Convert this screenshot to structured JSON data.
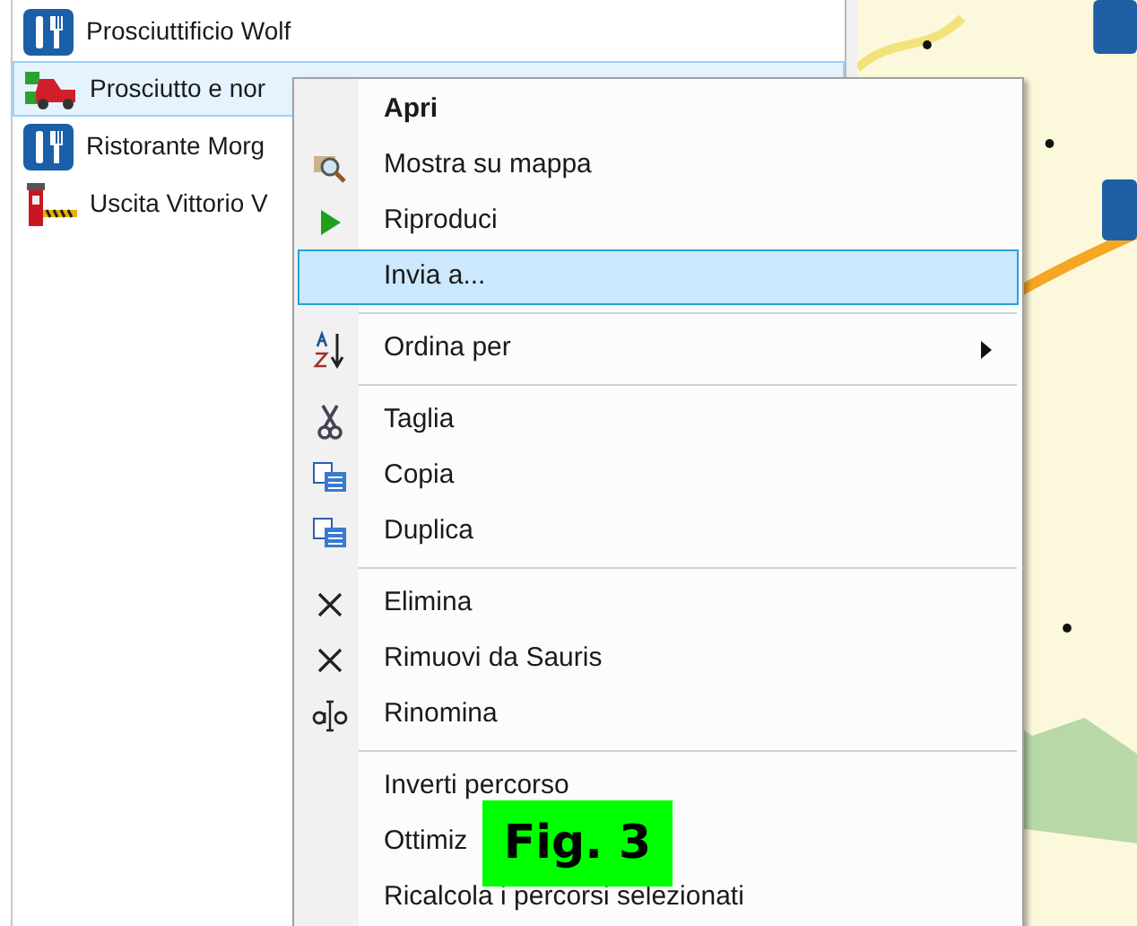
{
  "list": {
    "items": [
      {
        "label": "Prosciuttificio Wolf",
        "selected": false
      },
      {
        "label": "Prosciutto e nor",
        "selected": true
      },
      {
        "label": "Ristorante Morg",
        "selected": false
      },
      {
        "label": "Uscita Vittorio V",
        "selected": false
      }
    ]
  },
  "context_menu": {
    "items": [
      {
        "kind": "item",
        "label": "Apri",
        "default": true,
        "selected": false,
        "submenu": false
      },
      {
        "kind": "item",
        "label": "Mostra su mappa",
        "default": false,
        "selected": false,
        "submenu": false
      },
      {
        "kind": "item",
        "label": "Riproduci",
        "default": false,
        "selected": false,
        "submenu": false
      },
      {
        "kind": "item",
        "label": "Invia a...",
        "default": false,
        "selected": true,
        "submenu": false
      },
      {
        "kind": "separator"
      },
      {
        "kind": "item",
        "label": "Ordina per",
        "default": false,
        "selected": false,
        "submenu": true
      },
      {
        "kind": "separator"
      },
      {
        "kind": "item",
        "label": "Taglia",
        "default": false,
        "selected": false,
        "submenu": false
      },
      {
        "kind": "item",
        "label": "Copia",
        "default": false,
        "selected": false,
        "submenu": false
      },
      {
        "kind": "item",
        "label": "Duplica",
        "default": false,
        "selected": false,
        "submenu": false
      },
      {
        "kind": "separator"
      },
      {
        "kind": "item",
        "label": "Elimina",
        "default": false,
        "selected": false,
        "submenu": false
      },
      {
        "kind": "item",
        "label": "Rimuovi da Sauris",
        "default": false,
        "selected": false,
        "submenu": false
      },
      {
        "kind": "item",
        "label": "Rinomina",
        "default": false,
        "selected": false,
        "submenu": false
      },
      {
        "kind": "separator"
      },
      {
        "kind": "item",
        "label": "Inverti percorso",
        "default": false,
        "selected": false,
        "submenu": false
      },
      {
        "kind": "item",
        "label": "Ottimiz",
        "default": false,
        "selected": false,
        "submenu": false
      },
      {
        "kind": "item",
        "label": "Ricalcola i percorsi selezionati",
        "default": false,
        "selected": false,
        "submenu": false
      }
    ]
  },
  "figure_label": "Fig. 3"
}
